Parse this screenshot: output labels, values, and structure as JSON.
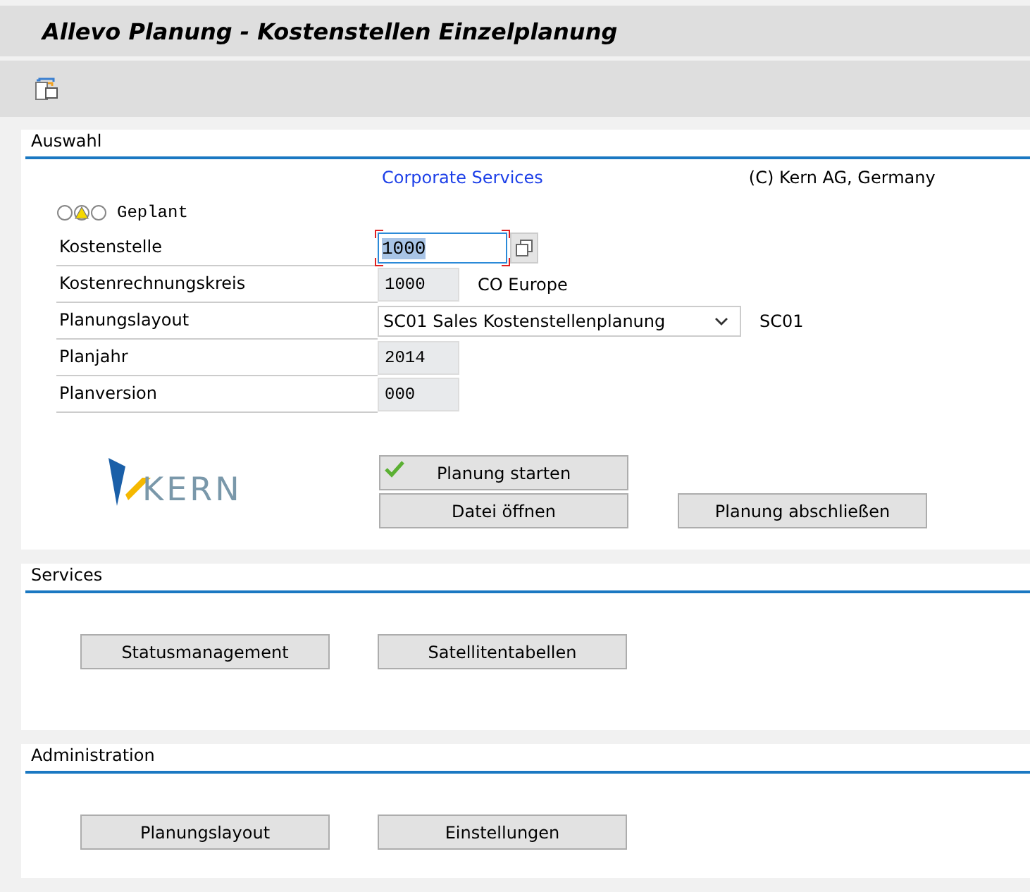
{
  "window": {
    "title": "Allevo Planung - Kostenstellen Einzelplanung"
  },
  "toolbar": {
    "items": [
      {
        "kind": "copy"
      }
    ]
  },
  "auswahl": {
    "title": "Auswahl",
    "link": "Corporate Services",
    "copyright": "(C) Kern AG, Germany",
    "status": {
      "kind": "warning",
      "text": "Geplant"
    },
    "fields": [
      {
        "kind": "input",
        "label": "Kostenstelle",
        "value": "1000",
        "focused": true,
        "help": true
      },
      {
        "kind": "display",
        "label": "Kostenrechnungskreis",
        "value": "1000",
        "note": "CO Europe"
      },
      {
        "kind": "dropdown",
        "label": "Planungslayout",
        "value": "SC01 Sales Kostenstellenplanung",
        "note": "SC01"
      },
      {
        "kind": "display",
        "label": "Planjahr",
        "value": "2014"
      },
      {
        "kind": "display",
        "label": "Planversion",
        "value": "000"
      }
    ],
    "logo": {
      "text": "KERN"
    },
    "buttons": [
      {
        "label": "Planung starten",
        "kind": "start"
      },
      {
        "label": "Datei öffnen",
        "kind": "open"
      },
      {
        "label": "Planung abschließen",
        "kind": "finish"
      }
    ]
  },
  "sections": [
    {
      "title": "Services",
      "buttons": [
        "Statusmanagement",
        "Satellitentabellen"
      ]
    },
    {
      "title": "Administration",
      "buttons": [
        "Planungslayout",
        "Einstellungen"
      ]
    }
  ]
}
